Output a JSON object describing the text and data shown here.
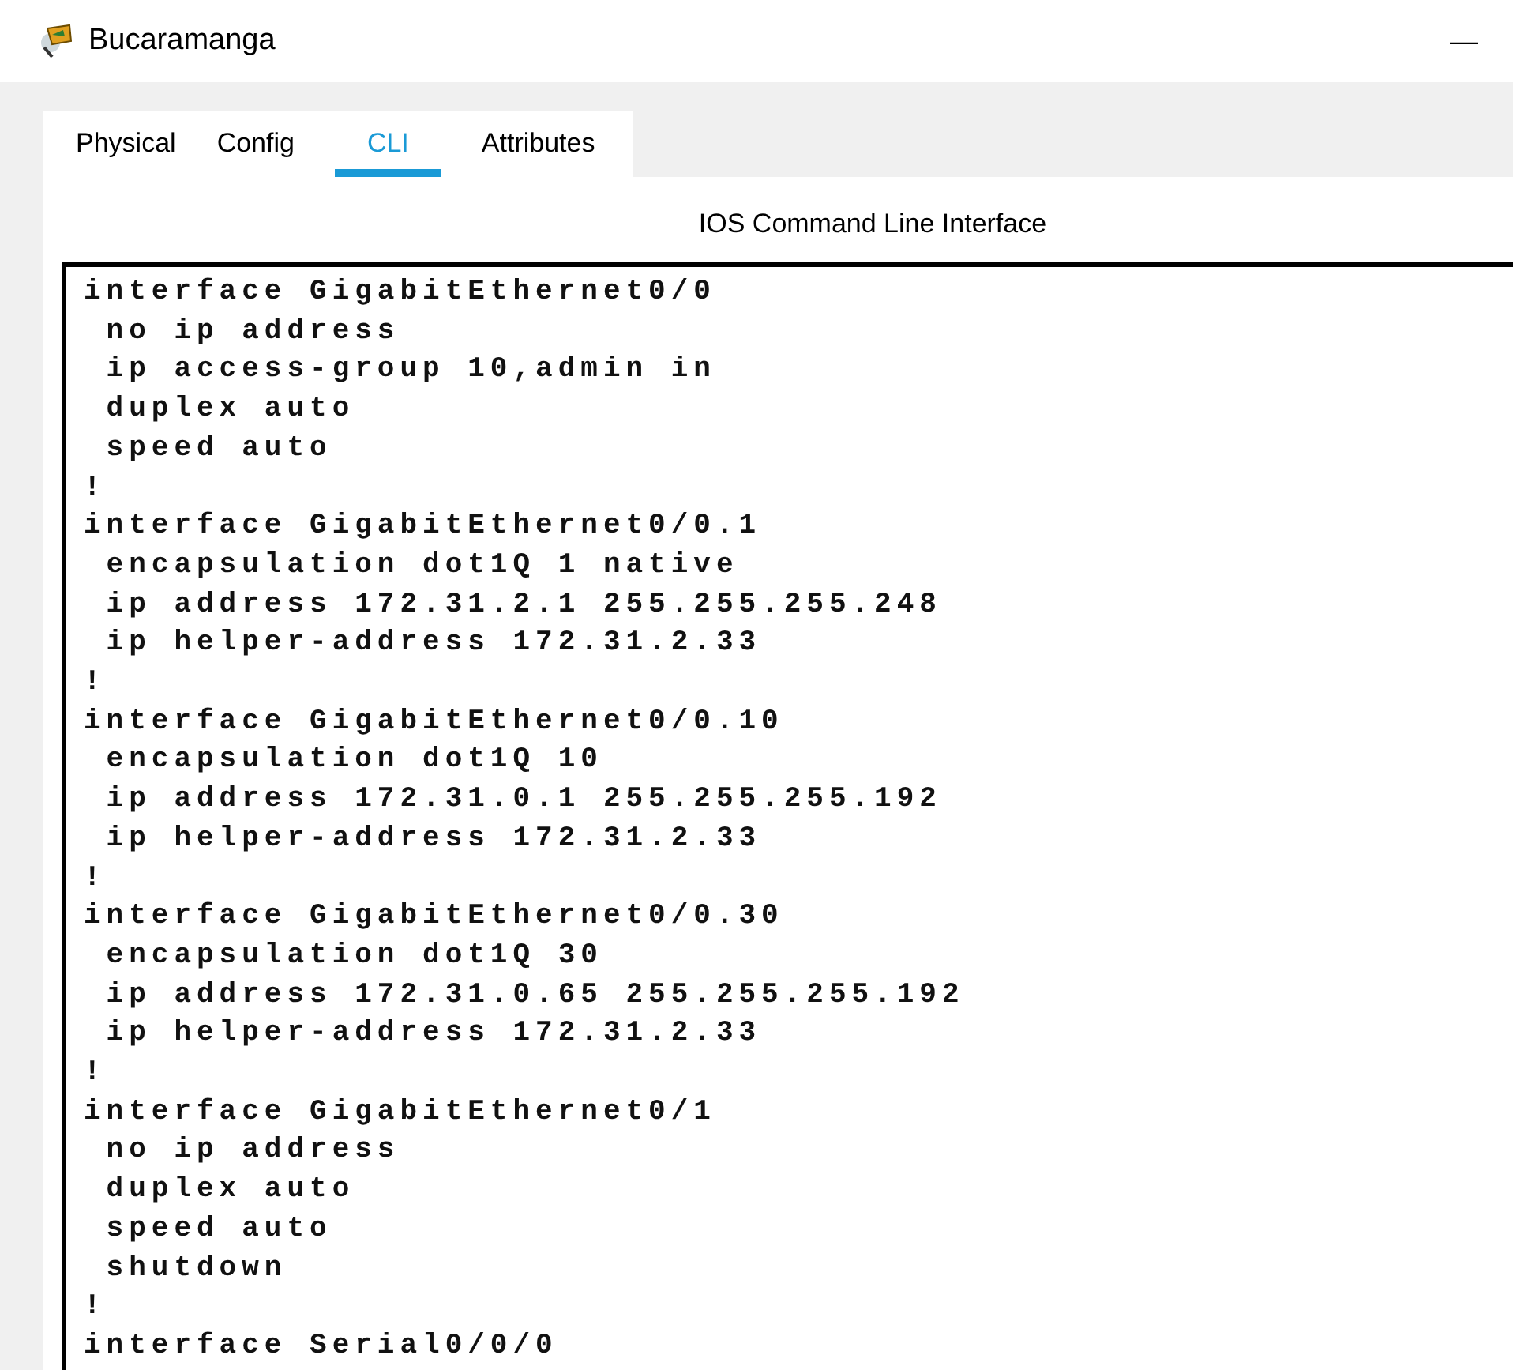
{
  "window": {
    "title": "Bucaramanga",
    "minimize": "—"
  },
  "tabs": [
    {
      "label": "Physical",
      "selected": false
    },
    {
      "label": "Config",
      "selected": false
    },
    {
      "label": "CLI",
      "selected": true
    },
    {
      "label": "Attributes",
      "selected": false
    }
  ],
  "cli": {
    "heading": "IOS Command Line Interface",
    "lines": [
      "interface GigabitEthernet0/0",
      " no ip address",
      " ip access-group 10,admin in",
      " duplex auto",
      " speed auto",
      "!",
      "interface GigabitEthernet0/0.1",
      " encapsulation dot1Q 1 native",
      " ip address 172.31.2.1 255.255.255.248",
      " ip helper-address 172.31.2.33",
      "!",
      "interface GigabitEthernet0/0.10",
      " encapsulation dot1Q 10",
      " ip address 172.31.0.1 255.255.255.192",
      " ip helper-address 172.31.2.33",
      "!",
      "interface GigabitEthernet0/0.30",
      " encapsulation dot1Q 30",
      " ip address 172.31.0.65 255.255.255.192",
      " ip helper-address 172.31.2.33",
      "!",
      "interface GigabitEthernet0/1",
      " no ip address",
      " duplex auto",
      " speed auto",
      " shutdown",
      "!",
      "interface Serial0/0/0"
    ]
  }
}
